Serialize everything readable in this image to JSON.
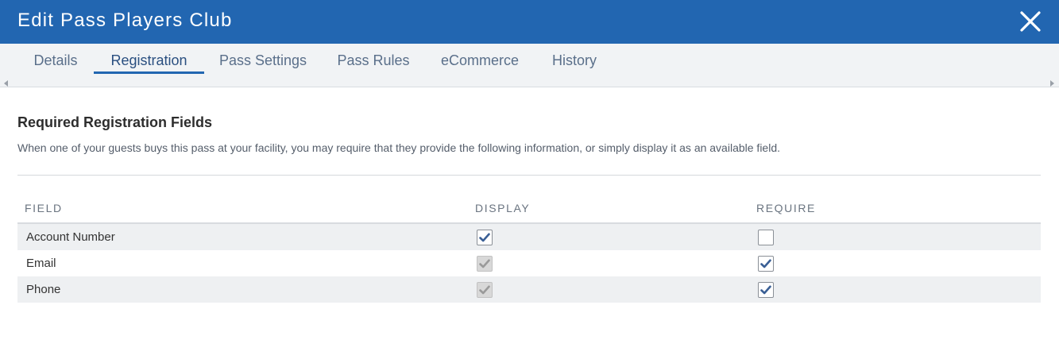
{
  "dialog": {
    "title": "Edit Pass Players Club"
  },
  "tabs": [
    {
      "label": "Details",
      "active": false
    },
    {
      "label": "Registration",
      "active": true
    },
    {
      "label": "Pass Settings",
      "active": false
    },
    {
      "label": "Pass Rules",
      "active": false
    },
    {
      "label": "eCommerce",
      "active": false
    },
    {
      "label": "History",
      "active": false
    }
  ],
  "section": {
    "title": "Required Registration Fields",
    "description": "When one of your guests buys this pass at your facility, you may require that they provide the following information, or simply display it as an available field."
  },
  "table": {
    "headers": {
      "field": "FIELD",
      "display": "DISPLAY",
      "require": "REQUIRE"
    },
    "rows": [
      {
        "field": "Account Number",
        "display": {
          "checked": true,
          "disabled": false
        },
        "require": {
          "checked": false,
          "disabled": false
        }
      },
      {
        "field": "Email",
        "display": {
          "checked": true,
          "disabled": true
        },
        "require": {
          "checked": true,
          "disabled": false
        }
      },
      {
        "field": "Phone",
        "display": {
          "checked": true,
          "disabled": true
        },
        "require": {
          "checked": true,
          "disabled": false
        }
      }
    ]
  },
  "colors": {
    "header_bg": "#2266b1",
    "tab_active_underline": "#2266b1",
    "checkmark": "#3a5f95",
    "checkmark_disabled": "#9a9a9a"
  },
  "icons": {
    "close": "close-icon",
    "scroll_left": "chevron-left-icon",
    "scroll_right": "chevron-right-icon",
    "check": "check-icon"
  }
}
